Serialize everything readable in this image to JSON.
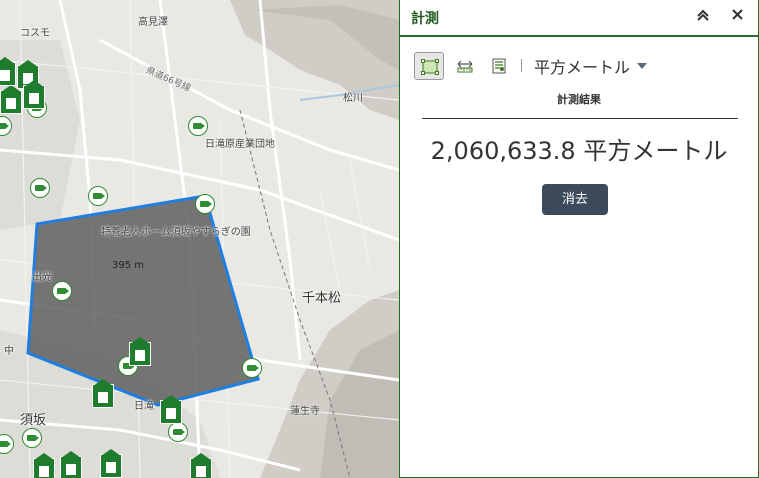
{
  "map": {
    "place_labels": [
      {
        "text": "コスモ",
        "style": "normal"
      },
      {
        "text": "高見澤",
        "style": "normal"
      },
      {
        "text": "県道66号線",
        "style": "road"
      },
      {
        "text": "日滝原産業団地",
        "style": "normal"
      },
      {
        "text": "特養老人ホーム須坂やすらぎの園",
        "style": "normal"
      },
      {
        "text": "395 m",
        "style": "normal"
      },
      {
        "text": "出光",
        "style": "normal"
      },
      {
        "text": "千本松",
        "style": "big"
      },
      {
        "text": "須坂",
        "style": "big"
      },
      {
        "text": "日滝",
        "style": "normal"
      },
      {
        "text": "蓮生寺",
        "style": "normal"
      },
      {
        "text": "松川",
        "style": "normal"
      },
      {
        "text": "中",
        "style": "normal"
      }
    ],
    "polygon_color": "#1f7fe0",
    "polygon_fill": "#5f5f5f",
    "marker_green": "#1e7d2c"
  },
  "panel": {
    "title": "計測",
    "collapse_icon": "double-chevron-up-icon",
    "close_icon": "close-icon",
    "tools": [
      {
        "icon": "area-measure-icon",
        "active": true
      },
      {
        "icon": "distance-measure-icon",
        "active": false
      },
      {
        "icon": "location-measure-icon",
        "active": false
      }
    ],
    "unit": "平方メートル",
    "result_heading": "計測結果",
    "result_value": "2,060,633.8 平方メートル",
    "clear_label": "消去"
  }
}
